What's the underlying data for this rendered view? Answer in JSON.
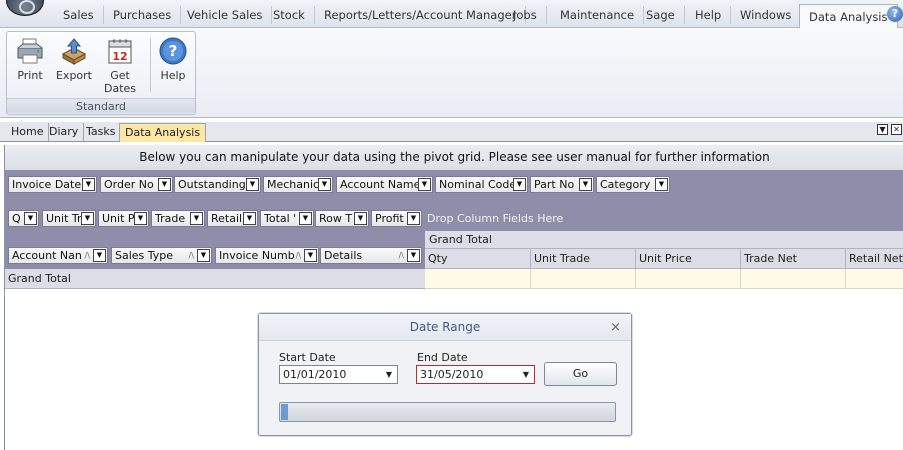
{
  "menubar": {
    "tabs": [
      {
        "label": "Sales"
      },
      {
        "label": "Purchases"
      },
      {
        "label": "Vehicle Sales"
      },
      {
        "label": "Stock"
      },
      {
        "label": "Reports/Letters/Account Manager"
      },
      {
        "label": "Jobs"
      },
      {
        "label": "Maintenance"
      },
      {
        "label": "Sage"
      },
      {
        "label": "Help"
      },
      {
        "label": "Windows"
      },
      {
        "label": "Data Analysis"
      }
    ],
    "active_tab": "Data Analysis",
    "help_glyph": "?"
  },
  "ribbon": {
    "group_label": "Standard",
    "buttons": [
      {
        "label": "Print",
        "icon": "printer-icon"
      },
      {
        "label": "Export",
        "icon": "export-icon"
      },
      {
        "label_line1": "Get",
        "label_line2": "Dates",
        "icon": "calendar-icon",
        "calendar_number": "12"
      },
      {
        "label": "Help",
        "icon": "help-icon",
        "glyph": "?"
      }
    ]
  },
  "doc_tabs": {
    "tabs": [
      {
        "label": "Home"
      },
      {
        "label": "Diary"
      },
      {
        "label": "Tasks"
      },
      {
        "label": "Data Analysis"
      }
    ],
    "active": "Data Analysis"
  },
  "pivot": {
    "header_text": "Below you can manipulate your data using the pivot grid.  Please see user manual for further information",
    "filter_fields": [
      {
        "label": "Invoice Date"
      },
      {
        "label": "Order No"
      },
      {
        "label": "Outstanding"
      },
      {
        "label": "Mechanic"
      },
      {
        "label": "Account Name"
      },
      {
        "label": "Nominal Code"
      },
      {
        "label": "Part No"
      },
      {
        "label": "Category"
      }
    ],
    "data_fields": [
      {
        "label": "Q"
      },
      {
        "label": "Unit Tr"
      },
      {
        "label": "Unit P"
      },
      {
        "label": "Trade"
      },
      {
        "label": "Retail"
      },
      {
        "label": "Total '"
      },
      {
        "label": "Row T"
      },
      {
        "label": "Profit"
      }
    ],
    "drop_hint": "Drop Column Fields Here",
    "row_fields": [
      {
        "label": "Account Nan",
        "sort": "/\\"
      },
      {
        "label": "Sales Type",
        "sort": "/\\"
      },
      {
        "label": "Invoice Numb",
        "sort": "/\\"
      },
      {
        "label": "Details",
        "sort": "/\\"
      }
    ],
    "grand_total_label": "Grand Total",
    "row_grand_total_label": "Grand Total",
    "columns": [
      {
        "label": "Qty"
      },
      {
        "label": "Unit Trade"
      },
      {
        "label": "Unit Price"
      },
      {
        "label": "Trade Net"
      },
      {
        "label": "Retail Net"
      }
    ]
  },
  "dialog": {
    "title": "Date Range",
    "close_glyph": "×",
    "start_date_label": "Start Date",
    "start_date_value": "01/01/2010",
    "end_date_label": "End Date",
    "end_date_value": "31/05/2010",
    "go_label": "Go",
    "progress_fraction": 0.02
  }
}
